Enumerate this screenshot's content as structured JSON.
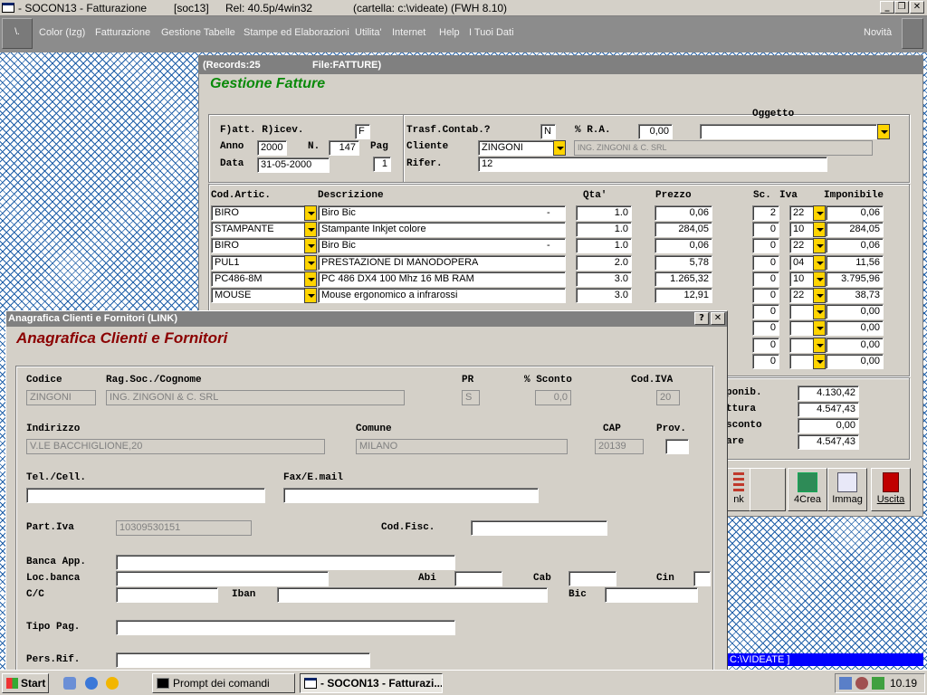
{
  "window": {
    "title": "- SOCON13 - Fatturazione",
    "soc": "[soc13]",
    "rel": "Rel: 40.5p/4win32",
    "folder": "(cartella: c:\\videate) (FWH 8.10)"
  },
  "menu": {
    "icon_label": "\\.",
    "items": [
      "Color (Izg)",
      "Fatturazione",
      "Gestione Tabelle",
      "Stampe ed Elaborazioni",
      "Utilita'",
      "Internet",
      "Help",
      "I Tuoi Dati"
    ],
    "novita": "Novità"
  },
  "invoice": {
    "records": "(Records:25",
    "file": "File:FATTURE)",
    "title": "Gestione Fatture",
    "labels": {
      "fatt": "F)att. R)icev.",
      "anno": "Anno",
      "n": "N.",
      "pag": "Pag",
      "data": "Data",
      "trasf": "Trasf.Contab.?",
      "ra": "% R.A.",
      "oggetto": "Oggetto",
      "cliente": "Cliente",
      "rifer": "Rifer."
    },
    "values": {
      "fatt": "F",
      "anno": "2000",
      "n": "147",
      "pag": "1",
      "data": "31-05-2000",
      "trasf": "N",
      "ra": "0,00",
      "oggetto": "",
      "cliente": "ZINGONI",
      "cliente_name": "ING. ZINGONI & C. SRL",
      "rifer": "12"
    },
    "columns": {
      "cod": "Cod.Artic.",
      "desc": "Descrizione",
      "qta": "Qta'",
      "prezzo": "Prezzo",
      "sc": "Sc.",
      "iva": "Iva",
      "imp": "Imponibile"
    },
    "rows": [
      {
        "cod": "BIRO",
        "desc": "Biro Bic",
        "mark": "-",
        "qta": "1.0",
        "prezzo": "0,06",
        "sc": "2",
        "iva": "22",
        "imp": "0,06"
      },
      {
        "cod": "STAMPANTE",
        "desc": "Stampante Inkjet colore",
        "mark": "",
        "qta": "1.0",
        "prezzo": "284,05",
        "sc": "0",
        "iva": "10",
        "imp": "284,05"
      },
      {
        "cod": "BIRO",
        "desc": "Biro Bic",
        "mark": "-",
        "qta": "1.0",
        "prezzo": "0,06",
        "sc": "0",
        "iva": "22",
        "imp": "0,06"
      },
      {
        "cod": "PUL1",
        "desc": "PRESTAZIONE DI MANODOPERA",
        "mark": "",
        "qta": "2.0",
        "prezzo": "5,78",
        "sc": "0",
        "iva": "04",
        "imp": "11,56"
      },
      {
        "cod": "PC486-8M",
        "desc": "PC 486 DX4 100 Mhz 16 MB RAM",
        "mark": "",
        "qta": "3.0",
        "prezzo": "1.265,32",
        "sc": "0",
        "iva": "10",
        "imp": "3.795,96"
      },
      {
        "cod": "MOUSE",
        "desc": "Mouse ergonomico a infrarossi",
        "mark": "",
        "qta": "3.0",
        "prezzo": "12,91",
        "sc": "0",
        "iva": "22",
        "imp": "38,73"
      }
    ],
    "empty_rows": [
      {
        "sc": "0",
        "imp": "0,00"
      },
      {
        "sc": "0",
        "imp": "0,00"
      },
      {
        "sc": "0",
        "imp": "0,00"
      },
      {
        "sc": "0",
        "imp": "0,00"
      }
    ],
    "totals": [
      {
        "label": "ponib.",
        "value": "4.130,42"
      },
      {
        "label": "ttura",
        "value": "4.547,43"
      },
      {
        "label": "sconto",
        "value": "0,00"
      },
      {
        "label": "are",
        "value": "4.547,43"
      }
    ],
    "buttons": {
      "link": "nk",
      "crea": "4Crea",
      "immag": "Immag",
      "uscita": "Uscita"
    }
  },
  "dialog": {
    "titlebar": "Anagrafica Clienti e Fornitori   (LINK)",
    "title": "Anagrafica Clienti e Fornitori",
    "help": "?",
    "close": "✕",
    "labels": {
      "codice": "Codice",
      "ragsoc": "Rag.Soc./Cognome",
      "pr": "PR",
      "sconto": "% Sconto",
      "codiva": "Cod.IVA",
      "indirizzo": "Indirizzo",
      "comune": "Comune",
      "cap": "CAP",
      "prov": "Prov.",
      "tel": "Tel./Cell.",
      "fax": "Fax/E.mail",
      "piva": "Part.Iva",
      "codfisc": "Cod.Fisc.",
      "banca": "Banca App.",
      "locbanca": "Loc.banca",
      "abi": "Abi",
      "cab": "Cab",
      "cin": "Cin",
      "cc": "C/C",
      "iban": "Iban",
      "bic": "Bic",
      "tipopag": "Tipo Pag.",
      "persrif": "Pers.Rif."
    },
    "values": {
      "codice": "ZINGONI",
      "ragsoc": "ING. ZINGONI & C. SRL",
      "pr": "S",
      "sconto": "0,0",
      "codiva": "20",
      "indirizzo": "V.LE BACCHIGLIONE,20",
      "comune": "MILANO",
      "cap": "20139",
      "prov": "",
      "tel": "",
      "fax": "",
      "piva": "10309530151",
      "codfisc": "",
      "banca": "",
      "locbanca": "",
      "abi": "",
      "cab": "",
      "cin": "",
      "cc": "",
      "iban": "",
      "bic": "",
      "tipopag": "",
      "persrif": ""
    }
  },
  "statusbar": {
    "path": "C:\\VIDEATE ]"
  },
  "taskbar": {
    "start": "Start",
    "tasks": [
      "Prompt dei comandi",
      "- SOCON13 - Fatturazi..."
    ],
    "clock": "10.19"
  }
}
